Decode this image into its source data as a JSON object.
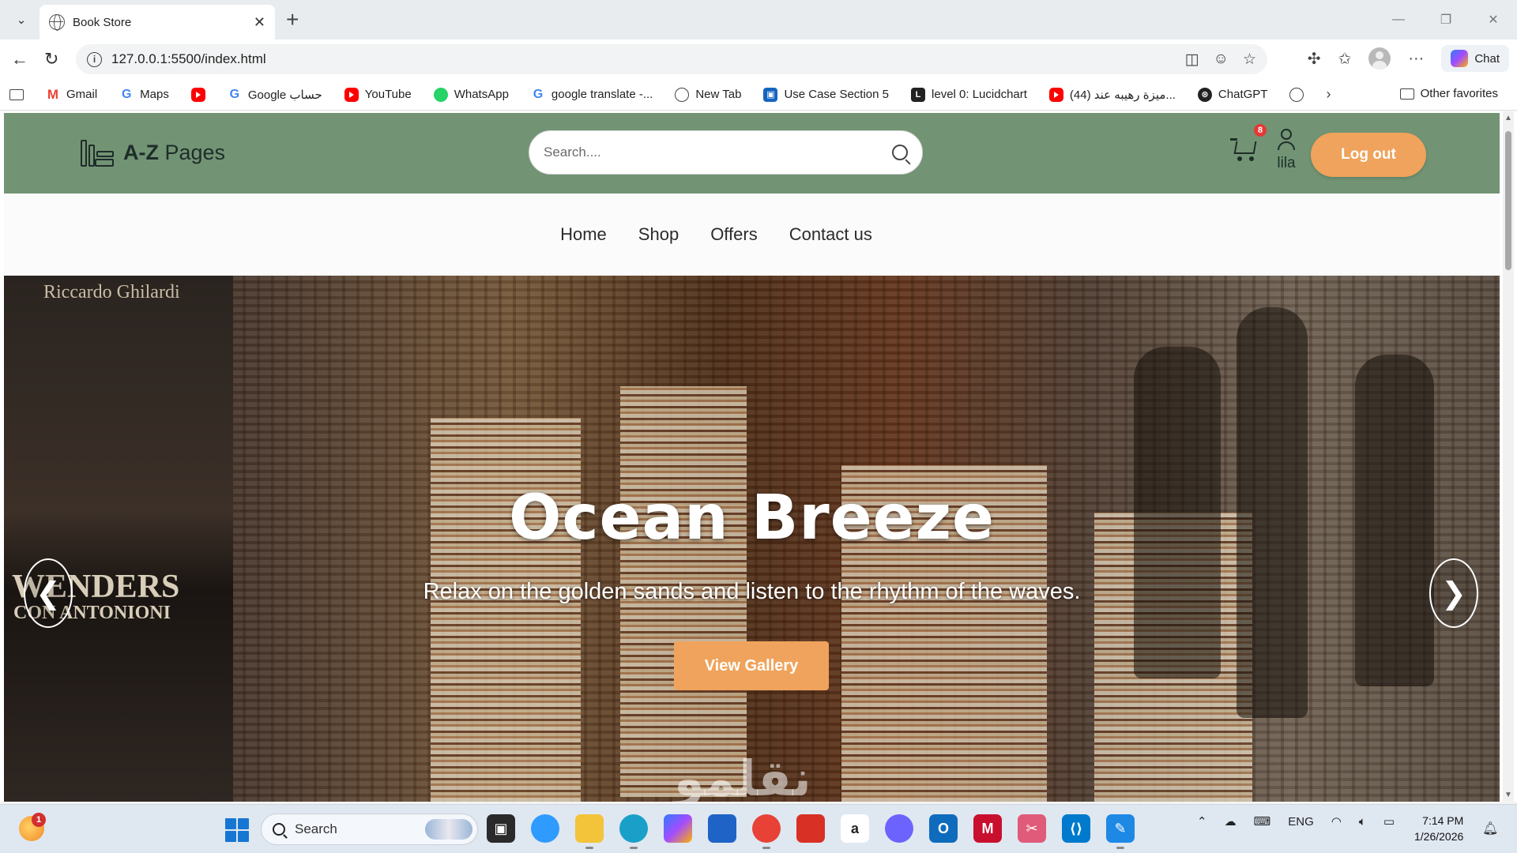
{
  "browser": {
    "tab_title": "Book Store",
    "tab_close": "✕",
    "new_tab": "+",
    "url": "127.0.0.1:5500/index.html",
    "chat_label": "Chat",
    "window_controls": [
      "—",
      "❐",
      "✕"
    ],
    "bookmarks": [
      {
        "label": "Gmail",
        "icon": "gmail-icon"
      },
      {
        "label": "Maps",
        "icon": "google-icon"
      },
      {
        "label": "",
        "icon": "youtube-icon"
      },
      {
        "label": "Google حساب",
        "icon": "google-icon"
      },
      {
        "label": "YouTube",
        "icon": "youtube-icon"
      },
      {
        "label": "WhatsApp",
        "icon": "whatsapp-icon"
      },
      {
        "label": "google translate -...",
        "icon": "google-icon"
      },
      {
        "label": "New Tab",
        "icon": "globe-icon"
      },
      {
        "label": "Use Case Section 5",
        "icon": "usecase-icon"
      },
      {
        "label": "level 0: Lucidchart",
        "icon": "lucidchart-icon"
      },
      {
        "label": "(44) ميزة رهيبه عند...",
        "icon": "youtube-icon"
      },
      {
        "label": "ChatGPT",
        "icon": "chatgpt-icon"
      },
      {
        "label": "",
        "icon": "globe-icon"
      }
    ],
    "other_favorites": "Other favorites"
  },
  "site": {
    "logo_bold": "A-Z",
    "logo_rest": " Pages",
    "search_placeholder": "Search....",
    "cart_count": "8",
    "username": "lila",
    "logout_label": "Log out",
    "nav": [
      "Home",
      "Shop",
      "Offers",
      "Contact us"
    ],
    "hero": {
      "title": "Ocean Breeze",
      "subtitle": "Relax on the golden sands and listen to the rhythm of the waves.",
      "button": "View Gallery",
      "prev": "❮",
      "next": "❯",
      "poster_top": "Riccardo Ghilardi",
      "poster_mid": "WENDERS",
      "poster_sub": "CON ANTONIONI",
      "watermark": "نقلمو"
    }
  },
  "taskbar": {
    "weather_badge": "1",
    "search_label": "Search",
    "tray_lang": "ENG",
    "time": "7:14 PM",
    "date": "1/26/2026",
    "apps": [
      {
        "icon": "copilot-icon",
        "color": "#2f9bff"
      },
      {
        "icon": "file-explorer-icon",
        "color": "#f3c43a"
      },
      {
        "icon": "edge-icon",
        "color": "#1aa0c8"
      },
      {
        "icon": "copilot-app-icon",
        "color": "#9b59ff"
      },
      {
        "icon": "store-icon",
        "color": "#2063c6"
      },
      {
        "icon": "chrome-icon",
        "color": "#e84135"
      },
      {
        "icon": "office-icon",
        "color": "#d93025"
      },
      {
        "icon": "amazon-icon",
        "color": "#222222"
      },
      {
        "icon": "copilot-logo-icon",
        "color": "#6c63ff"
      },
      {
        "icon": "outlook-icon",
        "color": "#0f6cbd"
      },
      {
        "icon": "mcafee-icon",
        "color": "#c8102e"
      },
      {
        "icon": "snipping-tool-icon",
        "color": "#e05a7a"
      },
      {
        "icon": "vscode-icon",
        "color": "#007acc"
      },
      {
        "icon": "paint-icon",
        "color": "#1e88e5"
      }
    ]
  }
}
